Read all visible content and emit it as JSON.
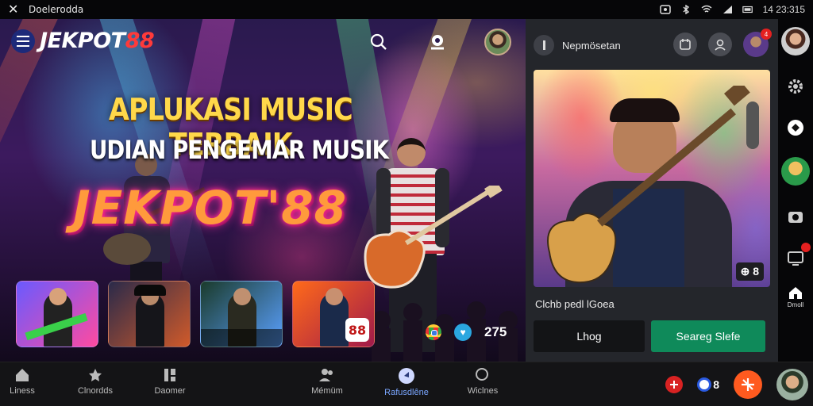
{
  "statusbar": {
    "app_name": "Doelerodda",
    "time": "14 23:315",
    "icons": [
      "close-icon",
      "screenshot-icon",
      "bluetooth-icon",
      "wifi-icon",
      "signal-icon",
      "battery-icon"
    ]
  },
  "header": {
    "brand_part1": "JEKPOT",
    "brand_part2": "88",
    "icons": [
      "menu-icon",
      "search-icon",
      "chat-icon",
      "profile-avatar"
    ]
  },
  "hero": {
    "line1": "APLUKASI MUSIC TERBAIK",
    "line2": "UDIAN PENGEMAR MUSIK",
    "line3": "JEKPOT'88",
    "thumb_badge": "88",
    "meta_count": "275",
    "thumbs": [
      {
        "gradient": [
          "#6a5aff",
          "#ff4aa0"
        ]
      },
      {
        "gradient": [
          "#2a2a4a",
          "#d05a2a"
        ]
      },
      {
        "gradient": [
          "#1a3a2a",
          "#5aa0ff"
        ]
      },
      {
        "gradient": [
          "#ff6a1a",
          "#a01a4a"
        ]
      }
    ]
  },
  "panel": {
    "title": "Nepmösetan",
    "caption": "Clchb pedl lGoea",
    "rating": "8",
    "button_secondary": "Lhog",
    "button_primary": "Seareg Slefe",
    "notif_count": "4"
  },
  "bottom_nav": {
    "items": [
      {
        "label": "Liness",
        "icon": "home-icon"
      },
      {
        "label": "Clnordds",
        "icon": "star-icon"
      },
      {
        "label": "Daomer",
        "icon": "library-icon"
      },
      {
        "label": "Mémüm",
        "icon": "people-icon"
      },
      {
        "label": "Rafusdlêne",
        "icon": "play-icon",
        "active": true
      },
      {
        "label": "Wiclnes",
        "icon": "search-icon"
      }
    ],
    "right_text": "8"
  },
  "rail": {
    "home_label": "Dmoll"
  },
  "colors": {
    "accent_green": "#0f8a5a",
    "brand_red": "#ff3a3a",
    "active_blue": "#7aa6ff",
    "fab_orange": "#ff5a1f"
  }
}
